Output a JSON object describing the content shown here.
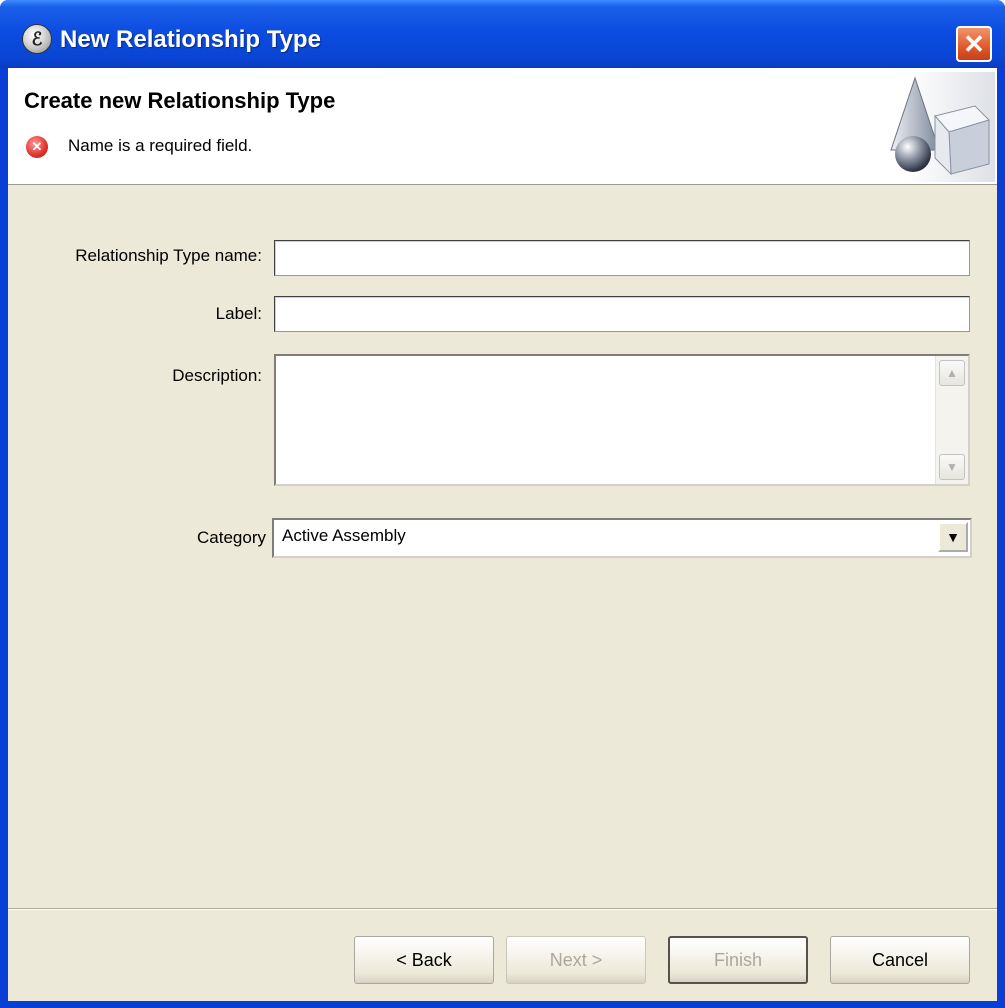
{
  "window": {
    "title": "New Relationship Type",
    "close_symbol": "✕",
    "app_icon": "app-logo-icon"
  },
  "banner": {
    "title": "Create new Relationship Type",
    "error_message": "Name is a required field.",
    "error_icon": "error-icon",
    "graphic": "wizard-shapes-graphic"
  },
  "form": {
    "name": {
      "label": "Relationship Type name:",
      "value": ""
    },
    "label": {
      "label": "Label:",
      "value": ""
    },
    "description": {
      "label": "Description:",
      "value": ""
    },
    "category": {
      "label": "Category",
      "value": "Active Assembly"
    }
  },
  "buttons": {
    "back": "< Back",
    "next": "Next >",
    "finish": "Finish",
    "cancel": "Cancel"
  },
  "colors": {
    "titlebar": "#0a46d4",
    "dialog_bg": "#ece9d8",
    "close_button": "#e05a2a",
    "disabled_text": "#aca899"
  }
}
